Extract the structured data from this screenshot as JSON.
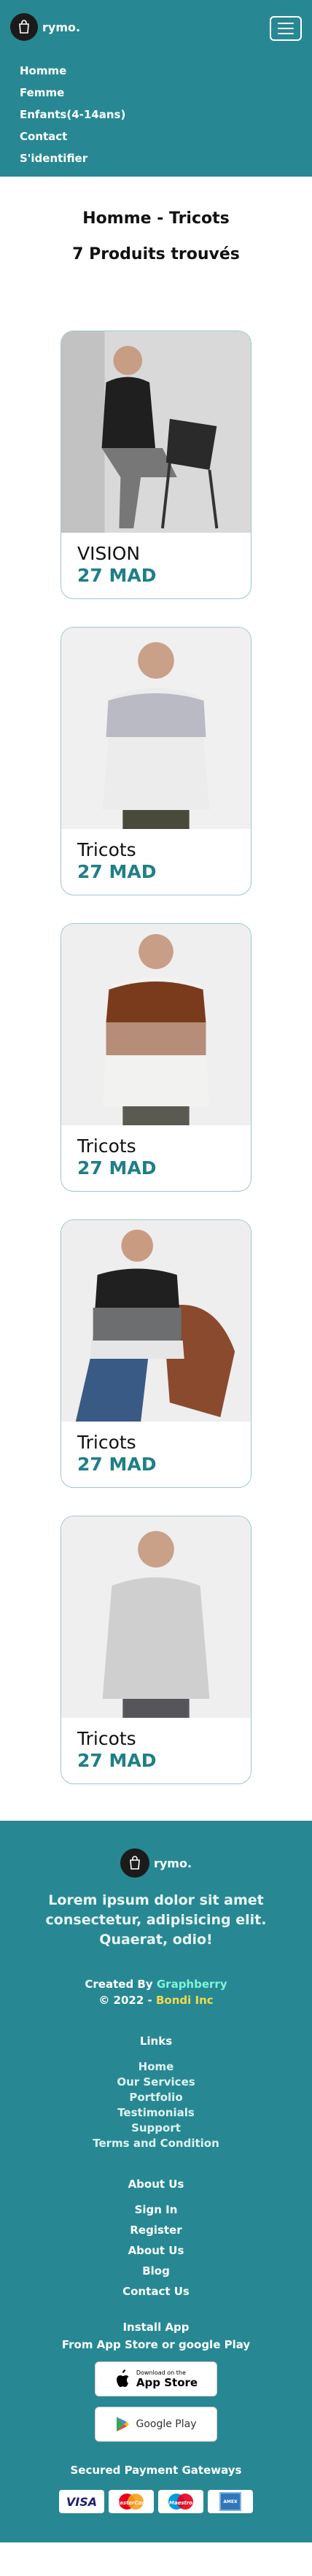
{
  "brand": {
    "name": "rymo."
  },
  "nav": {
    "items": [
      "Homme",
      "Femme",
      "Enfants(4-14ans)",
      "Contact",
      "S'identifier"
    ]
  },
  "main": {
    "title": "Homme - Tricots",
    "count": "7 Produits trouvés"
  },
  "products": [
    {
      "name": "VISION",
      "price": "27 MAD"
    },
    {
      "name": "Tricots",
      "price": "27 MAD"
    },
    {
      "name": "Tricots",
      "price": "27 MAD"
    },
    {
      "name": "Tricots",
      "price": "27 MAD"
    },
    {
      "name": "Tricots",
      "price": "27 MAD"
    }
  ],
  "footer": {
    "tagline": "Lorem ipsum dolor sit amet consectetur, adipisicing elit. Quaerat, odio!",
    "created_by_label": "Created By",
    "created_by": "Graphberry",
    "copyright": "© 2022 -",
    "company": "Bondi Inc",
    "links_title": "Links",
    "links": [
      "Home",
      "Our Services",
      "Portfolio",
      "Testimonials",
      "Support",
      "Terms and Condition"
    ],
    "about_title": "About Us",
    "about": [
      "Sign In",
      "Register",
      "About Us",
      "Blog",
      "Contact Us"
    ],
    "install_title": "Install App",
    "install_sub": "From App Store or google Play",
    "appstore_small": "Download on the",
    "appstore_big": "App Store",
    "googleplay": "Google Play",
    "payments_title": "Secured Payment Gateways",
    "payments": [
      "VISA",
      "MasterCard",
      "Maestro",
      "AMEX"
    ]
  },
  "colors": {
    "teal": "#278893",
    "price": "#1f7f87",
    "card_border": "#9cc7cc"
  }
}
